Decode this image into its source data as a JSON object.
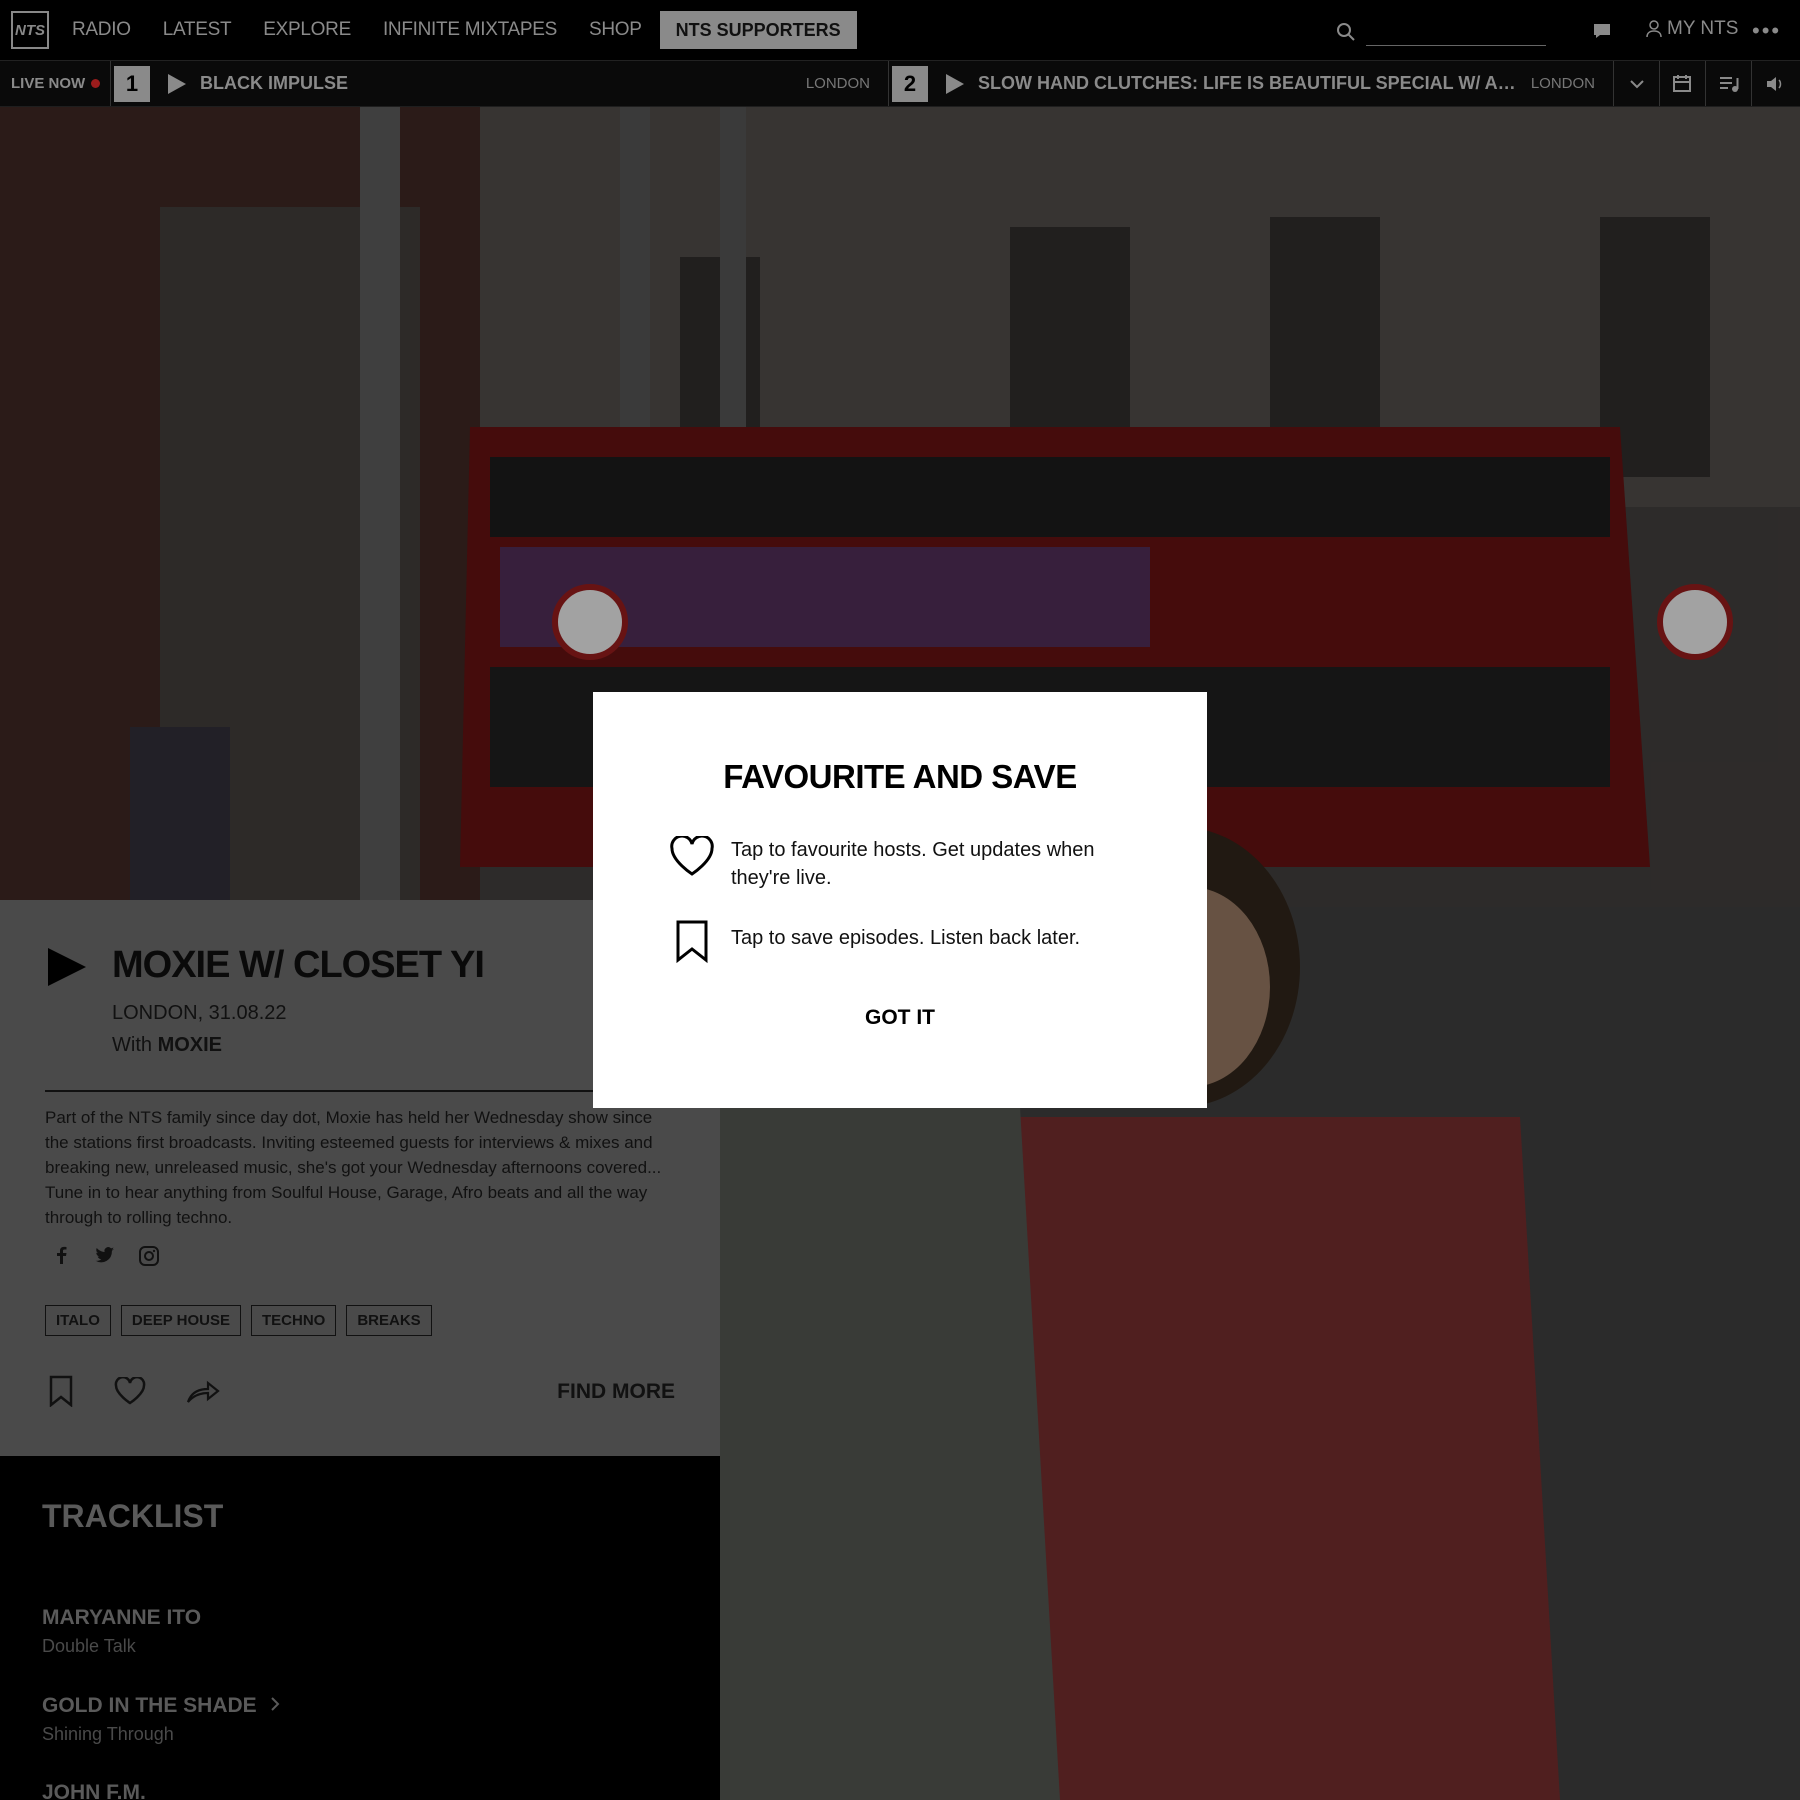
{
  "nav": {
    "logo": "NTS",
    "items": [
      "RADIO",
      "LATEST",
      "EXPLORE",
      "INFINITE MIXTAPES",
      "SHOP"
    ],
    "supporters": "NTS SUPPORTERS",
    "search_placeholder": "",
    "my_nts": "MY NTS"
  },
  "livebar": {
    "label": "LIVE NOW",
    "channels": [
      {
        "number": "1",
        "title": "BLACK IMPULSE",
        "location": "LONDON"
      },
      {
        "number": "2",
        "title": "SLOW HAND CLUTCHES: LIFE IS BEAUTIFUL SPECIAL W/ ALOISIUS",
        "location": "LONDON"
      }
    ]
  },
  "show": {
    "title": "MOXIE W/ CLOSET YI",
    "meta": "LONDON, 31.08.22",
    "with_prefix": "With",
    "host": "MOXIE",
    "description": "Part of the NTS family since day dot, Moxie has held her Wednesday show since the stations first broadcasts. Inviting esteemed guests for interviews & mixes and breaking new, unreleased music, she's got your Wednesday afternoons covered... Tune in to hear anything from Soulful House, Garage, Afro beats and all the way through to rolling techno.",
    "tags": [
      "ITALO",
      "DEEP HOUSE",
      "TECHNO",
      "BREAKS"
    ],
    "find_more": "FIND MORE"
  },
  "tracklist": {
    "heading": "TRACKLIST",
    "tracks": [
      {
        "artist": "MARYANNE ITO",
        "title": "Double Talk"
      },
      {
        "artist": "GOLD IN THE SHADE",
        "title": "Shining Through"
      },
      {
        "artist": "JOHN F.M.",
        "title": ""
      }
    ]
  },
  "modal": {
    "title": "FAVOURITE AND SAVE",
    "favourite_text": "Tap to favourite hosts. Get updates when they're live.",
    "save_text": "Tap to save episodes. Listen back later.",
    "button": "GOT IT"
  },
  "colors": {
    "accent_red": "#9b1c1c",
    "bus_red": "#7a1010",
    "overlay": "rgba(0,0,0,0.7)"
  }
}
